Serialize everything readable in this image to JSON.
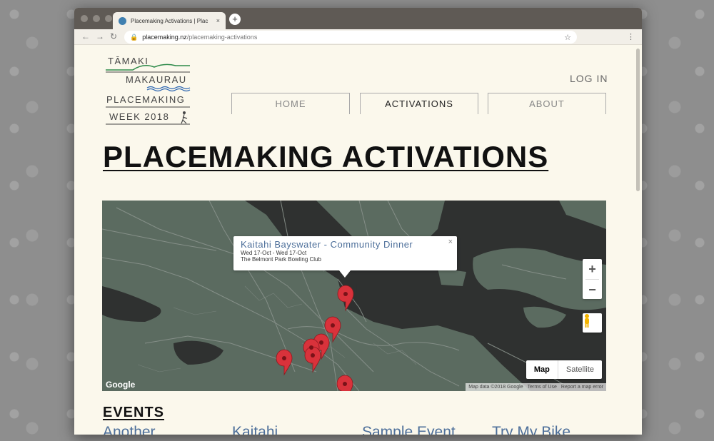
{
  "browser": {
    "tab_title": "Placemaking Activations | Plac",
    "tab_close": "×",
    "new_tab": "+",
    "url_host": "placemaking.nz",
    "url_path": "/placemaking-activations",
    "back": "←",
    "forward": "→",
    "reload": "↻",
    "star": "☆",
    "menu": "⋮"
  },
  "logo": {
    "line1": "TĀMAKI",
    "line2": "MAKAURAU",
    "line3": "PLACEMAKING",
    "line4": "WEEK 2018"
  },
  "header": {
    "login": "LOG IN",
    "nav": [
      "HOME",
      "ACTIVATIONS",
      "ABOUT"
    ],
    "active_nav": "ACTIVATIONS"
  },
  "page": {
    "title": "PLACEMAKING ACTIVATIONS"
  },
  "map": {
    "info_title": "Kaitahi Bayswater - Community Dinner",
    "info_dates": "Wed 17-Oct - Wed 17-Oct",
    "info_venue": "The Belmont Park Bowling Club",
    "info_close": "×",
    "zoom_in": "+",
    "zoom_out": "−",
    "type_map": "Map",
    "type_satellite": "Satellite",
    "google": "Google",
    "attribution": [
      "Map data ©2018 Google",
      "Terms of Use",
      "Report a map error"
    ],
    "colors": {
      "water": "#2f3130",
      "land": "#5b6b60",
      "road": "#8a938d",
      "marker": "#d9323b"
    }
  },
  "events": {
    "heading": "EVENTS",
    "items": [
      "Another",
      "Kaitahi",
      "Sample Event",
      "Try My Bike"
    ]
  }
}
